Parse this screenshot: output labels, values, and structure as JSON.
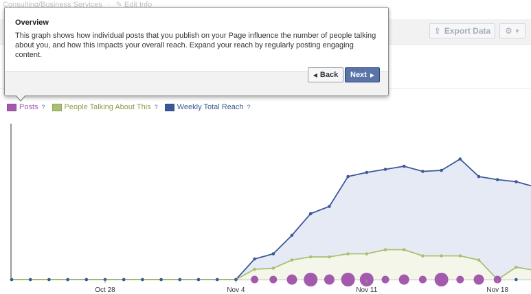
{
  "header": {
    "breadcrumb": [
      "Consulting/Business Services",
      "Edit Info"
    ],
    "export_label": "Export Data"
  },
  "popover": {
    "title": "Overview",
    "body": "This graph shows how individual posts that you publish on your Page influence the number of people talking about you, and how this impacts your overall reach. Expand your reach by regularly posting engaging content.",
    "back_label": "Back",
    "next_label": "Next"
  },
  "legend": {
    "items": [
      {
        "label": "Posts",
        "help": "?",
        "color": "#a35aad"
      },
      {
        "label": "People Talking About This",
        "help": "?",
        "color": "#a9c070"
      },
      {
        "label": "Weekly Total Reach",
        "help": "?",
        "color": "#3b5998"
      }
    ]
  },
  "chart_data": {
    "type": "line",
    "x_tick_labels": [
      "Oct 28",
      "Nov 4",
      "Nov 11",
      "Nov 18"
    ],
    "x_tick_day_index": [
      5,
      12,
      19,
      26
    ],
    "series": [
      {
        "name": "Weekly Total Reach",
        "color": "#3b5998",
        "values": [
          0,
          0,
          0,
          0,
          0,
          0,
          0,
          0,
          0,
          0,
          0,
          0,
          0,
          0.2,
          0.25,
          0.43,
          0.64,
          0.71,
          1.0,
          1.04,
          1.07,
          1.1,
          1.05,
          1.06,
          1.17,
          1.0,
          0.97,
          0.95,
          0.9
        ]
      },
      {
        "name": "People Talking About This",
        "color": "#a9c070",
        "values": [
          0,
          0,
          0,
          0,
          0,
          0,
          0,
          0,
          0,
          0,
          0,
          0,
          0,
          0.1,
          0.11,
          0.19,
          0.22,
          0.22,
          0.25,
          0.25,
          0.29,
          0.29,
          0.23,
          0.23,
          0.23,
          0.19,
          0.0,
          0.12,
          0.09
        ]
      },
      {
        "name": "Posts",
        "color": "#a35aad",
        "values": [
          0,
          0,
          0,
          0,
          0,
          0,
          0,
          0,
          0,
          0,
          0,
          0,
          0,
          1,
          1,
          2,
          3,
          2,
          3,
          3,
          1,
          2,
          1,
          3,
          1,
          2,
          1,
          0,
          0
        ]
      }
    ]
  }
}
